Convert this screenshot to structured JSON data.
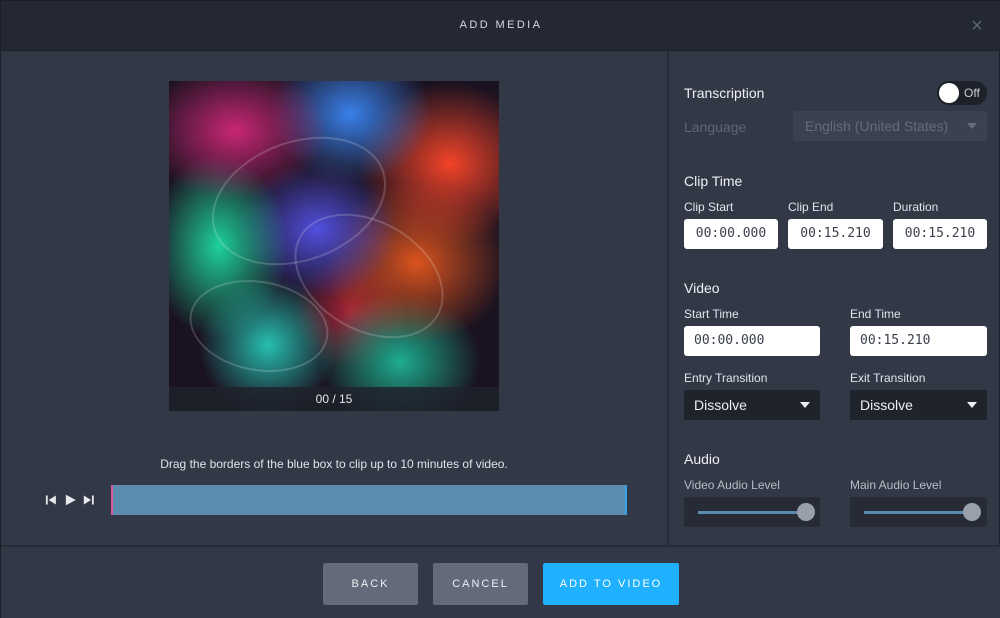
{
  "header": {
    "title": "ADD MEDIA",
    "close_glyph": "×"
  },
  "preview": {
    "counter": "00 / 15"
  },
  "hint": "Drag the borders of the blue box to clip up to 10 minutes of video.",
  "transcription": {
    "label": "Transcription",
    "toggle_label": "Off",
    "language_label": "Language",
    "language_value": "English (United States)"
  },
  "clip_time": {
    "heading": "Clip Time",
    "start_label": "Clip Start",
    "start_value": "00:00.000",
    "end_label": "Clip End",
    "end_value": "00:15.210",
    "duration_label": "Duration",
    "duration_value": "00:15.210"
  },
  "video": {
    "heading": "Video",
    "start_label": "Start Time",
    "start_value": "00:00.000",
    "end_label": "End Time",
    "end_value": "00:15.210",
    "entry_label": "Entry Transition",
    "entry_value": "Dissolve",
    "exit_label": "Exit Transition",
    "exit_value": "Dissolve"
  },
  "audio": {
    "heading": "Audio",
    "video_level_label": "Video Audio Level",
    "main_level_label": "Main Audio Level"
  },
  "footer": {
    "back": "BACK",
    "cancel": "CANCEL",
    "add": "ADD TO VIDEO"
  },
  "colors": {
    "accent": "#1fb0ff",
    "timeline": "#5a8cb0",
    "clip_start_marker": "#d85b9a"
  },
  "icons": [
    "close-icon",
    "skip-back-icon",
    "play-icon",
    "skip-forward-icon",
    "chevron-down-icon"
  ]
}
